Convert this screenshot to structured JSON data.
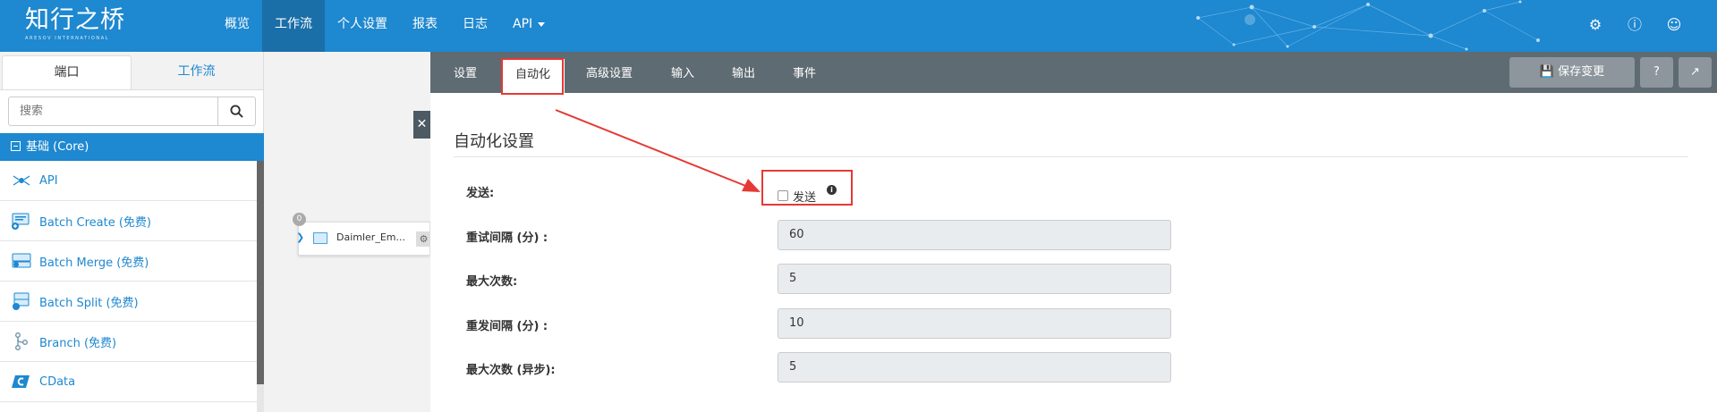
{
  "app": {
    "logo_text": "知行之桥",
    "logo_subtext": "ARESOV INTERNATIONAL"
  },
  "nav": {
    "items": [
      {
        "label": "概览"
      },
      {
        "label": "工作流"
      },
      {
        "label": "个人设置"
      },
      {
        "label": "报表"
      },
      {
        "label": "日志"
      },
      {
        "label": "API"
      }
    ],
    "active": "工作流"
  },
  "top_icons": [
    "gear-icon",
    "help-icon",
    "user-icon"
  ],
  "left_panel": {
    "tabs": [
      {
        "label": "端口"
      },
      {
        "label": "工作流"
      }
    ],
    "search": {
      "placeholder": "搜索"
    },
    "category": "基础 (Core)",
    "connectors": [
      {
        "label": "API",
        "icon": "api-icon"
      },
      {
        "label": "Batch Create (免费)",
        "icon": "batch-create-icon"
      },
      {
        "label": "Batch Merge (免费)",
        "icon": "batch-merge-icon"
      },
      {
        "label": "Batch Split (免费)",
        "icon": "batch-split-icon"
      },
      {
        "label": "Branch (免费)",
        "icon": "branch-icon"
      },
      {
        "label": "CData",
        "icon": "cdata-icon"
      }
    ]
  },
  "canvas": {
    "node": {
      "badge": "0",
      "label": "Daimler_Em..."
    }
  },
  "main": {
    "tabs": [
      {
        "label": "设置"
      },
      {
        "label": "自动化"
      },
      {
        "label": "高级设置"
      },
      {
        "label": "输入"
      },
      {
        "label": "输出"
      },
      {
        "label": "事件"
      }
    ],
    "active_tab": "自动化",
    "save_label": "保存变更",
    "section_title": "自动化设置",
    "fields": {
      "send_label": "发送:",
      "send_checkbox_label": "发送",
      "send_checked": false,
      "retry_interval_label": "重试间隔 (分) :",
      "retry_interval_value": "60",
      "max_attempts_label": "最大次数:",
      "max_attempts_value": "5",
      "resend_interval_label": "重发间隔 (分) :",
      "resend_interval_value": "10",
      "max_async_label": "最大次数 (异步):",
      "max_async_value": "5"
    }
  },
  "colors": {
    "brand_blue": "#1e88d0",
    "subnav_gray": "#5f6b72",
    "highlight_red": "#e53935"
  }
}
